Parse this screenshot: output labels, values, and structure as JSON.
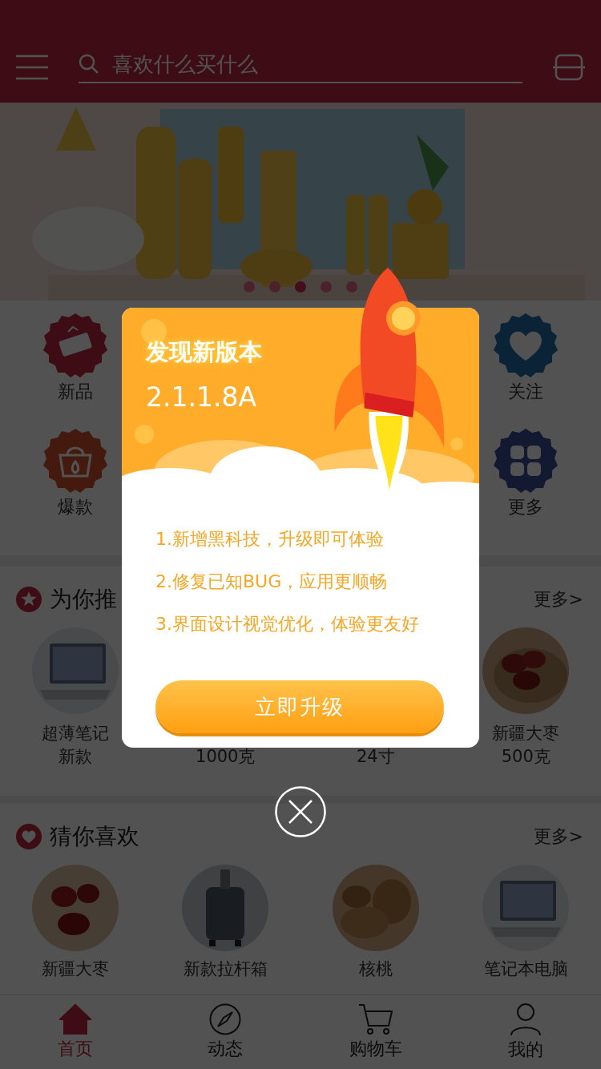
{
  "header": {
    "search_placeholder": "喜欢什么买什么"
  },
  "banner": {
    "dots": [
      {
        "selected": false
      },
      {
        "selected": false
      },
      {
        "selected": true
      },
      {
        "selected": false
      },
      {
        "selected": false
      }
    ]
  },
  "categories": [
    {
      "label": "新品",
      "kind": "new"
    },
    {
      "label": "关注",
      "kind": "heart"
    },
    {
      "label": "爆款",
      "kind": "basket"
    },
    {
      "label": "更多",
      "kind": "grid"
    }
  ],
  "recommend": {
    "title": "为你推",
    "more": "更多>",
    "items": [
      {
        "lines": [
          "超薄笔记",
          "新款"
        ]
      },
      {
        "lines": [
          "1000克"
        ]
      },
      {
        "lines": [
          "24寸"
        ]
      },
      {
        "lines": [
          "新疆大枣",
          "500克"
        ]
      }
    ]
  },
  "guess": {
    "title": "猜你喜欢",
    "more": "更多>",
    "items": [
      {
        "label": "新疆大枣"
      },
      {
        "label": "新款拉杆箱"
      },
      {
        "label": "核桃"
      },
      {
        "label": "笔记本电脑"
      }
    ]
  },
  "dialog": {
    "title": "发现新版本",
    "version": "2.1.1.8A",
    "notes": [
      "1.新增黑科技，升级即可体验",
      "2.修复已知BUG，应用更顺畅",
      "3.界面设计视觉优化，体验更友好"
    ],
    "button": "立即升级"
  },
  "tabbar": [
    {
      "label": "首页",
      "kind": "home",
      "selected": true
    },
    {
      "label": "动态",
      "kind": "compass",
      "selected": false
    },
    {
      "label": "购物车",
      "kind": "cart",
      "selected": false
    },
    {
      "label": "我的",
      "kind": "user",
      "selected": false
    }
  ]
}
